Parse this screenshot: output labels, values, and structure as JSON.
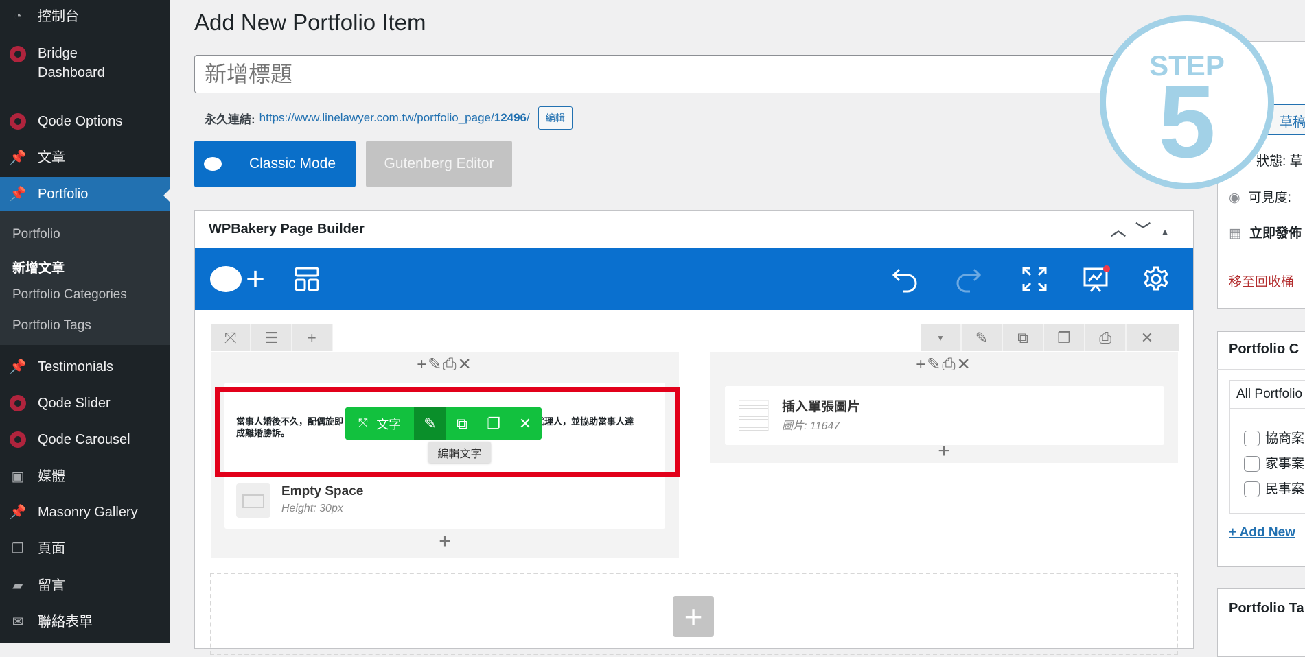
{
  "sidebar": {
    "items": [
      {
        "label": "控制台",
        "icon": "dashboard-icon"
      },
      {
        "label": "Bridge Dashboard",
        "icon": "qode-icon"
      },
      {
        "label": "Qode Options",
        "icon": "qode-icon"
      },
      {
        "label": "文章",
        "icon": "pin-icon"
      },
      {
        "label": "Portfolio",
        "icon": "pin-icon",
        "active": true
      },
      {
        "label": "Testimonials",
        "icon": "pin-icon"
      },
      {
        "label": "Qode Slider",
        "icon": "qode-icon"
      },
      {
        "label": "Qode Carousel",
        "icon": "qode-icon"
      },
      {
        "label": "媒體",
        "icon": "media-icon"
      },
      {
        "label": "Masonry Gallery",
        "icon": "pin-icon"
      },
      {
        "label": "頁面",
        "icon": "pages-icon"
      },
      {
        "label": "留言",
        "icon": "comment-icon"
      },
      {
        "label": "聯絡表單",
        "icon": "mail-icon"
      }
    ],
    "submenu": [
      "Portfolio",
      "新增文章",
      "Portfolio Categories",
      "Portfolio Tags"
    ]
  },
  "page": {
    "title": "Add New Portfolio Item",
    "title_placeholder": "新增標題",
    "permalink_label": "永久連結:",
    "permalink_base": "https://www.linelawyer.com.tw/portfolio_page/",
    "permalink_id": "12496",
    "permalink_slash": "/",
    "edit_label": "編輯",
    "classic_label": "Classic Mode",
    "gutenberg_label": "Gutenberg Editor"
  },
  "wpb": {
    "title": "WPBakery Page Builder",
    "text_content_left": "當事人婚後不久，配偶旋即",
    "text_content_right": "代理人，並協助當事人達",
    "text_content_end": "成離婚勝訴。",
    "green_label": "文字",
    "tooltip": "編輯文字",
    "empty_title": "Empty Space",
    "empty_sub": "Height: 30px",
    "image_title": "插入單張圖片",
    "image_sub": "圖片: 11647"
  },
  "step": {
    "word": "STEP",
    "number": "5"
  },
  "publish": {
    "draft_btn": "草稿",
    "status": "狀態: 草",
    "visibility": "可見度:",
    "publish_now": "立即發佈",
    "trash": "移至回收桶"
  },
  "categories": {
    "title": "Portfolio C",
    "tab": "All Portfolio",
    "items": [
      "協商案",
      "家事案",
      "民事案"
    ],
    "add_new": "+ Add New"
  },
  "tags": {
    "title": "Portfolio Ta"
  },
  "colors": {
    "accent": "#2271b1",
    "wpb_blue": "#0a70cf",
    "green": "#12c13e",
    "highlight_red": "#e2001a",
    "step_blue": "#a2d1e7"
  }
}
